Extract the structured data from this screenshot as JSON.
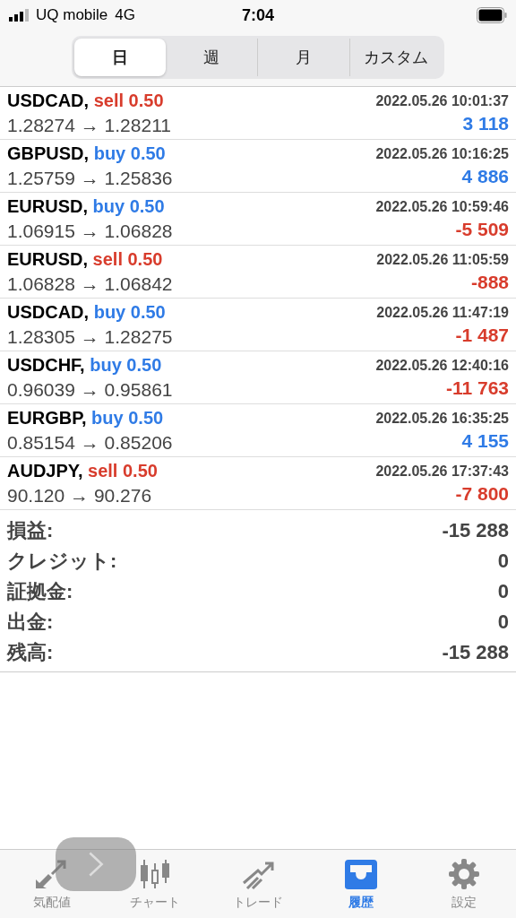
{
  "status_bar": {
    "carrier": "UQ mobile",
    "network": "4G",
    "time": "7:04"
  },
  "period_tabs": [
    {
      "label": "日",
      "selected": true
    },
    {
      "label": "週",
      "selected": false
    },
    {
      "label": "月",
      "selected": false
    },
    {
      "label": "カスタム",
      "selected": false
    }
  ],
  "deals": [
    {
      "symbol": "USDCAD,",
      "side": "sell",
      "volume": "0.50",
      "time": "2022.05.26 10:01:37",
      "prices": "1.28274 → 1.28211",
      "profit": "3 118",
      "positive": true
    },
    {
      "symbol": "GBPUSD,",
      "side": "buy",
      "volume": "0.50",
      "time": "2022.05.26 10:16:25",
      "prices": "1.25759 → 1.25836",
      "profit": "4 886",
      "positive": true
    },
    {
      "symbol": "EURUSD,",
      "side": "buy",
      "volume": "0.50",
      "time": "2022.05.26 10:59:46",
      "prices": "1.06915 → 1.06828",
      "profit": "-5 509",
      "positive": false
    },
    {
      "symbol": "EURUSD,",
      "side": "sell",
      "volume": "0.50",
      "time": "2022.05.26 11:05:59",
      "prices": "1.06828 → 1.06842",
      "profit": "-888",
      "positive": false
    },
    {
      "symbol": "USDCAD,",
      "side": "buy",
      "volume": "0.50",
      "time": "2022.05.26 11:47:19",
      "prices": "1.28305 → 1.28275",
      "profit": "-1 487",
      "positive": false
    },
    {
      "symbol": "USDCHF,",
      "side": "buy",
      "volume": "0.50",
      "time": "2022.05.26 12:40:16",
      "prices": "0.96039 → 0.95861",
      "profit": "-11 763",
      "positive": false
    },
    {
      "symbol": "EURGBP,",
      "side": "buy",
      "volume": "0.50",
      "time": "2022.05.26 16:35:25",
      "prices": "0.85154 → 0.85206",
      "profit": "4 155",
      "positive": true
    },
    {
      "symbol": "AUDJPY,",
      "side": "sell",
      "volume": "0.50",
      "time": "2022.05.26 17:37:43",
      "prices": "90.120 → 90.276",
      "profit": "-7 800",
      "positive": false
    }
  ],
  "summary": [
    {
      "label": "損益:",
      "value": "-15 288"
    },
    {
      "label": "クレジット:",
      "value": "0"
    },
    {
      "label": "証拠金:",
      "value": "0"
    },
    {
      "label": "出金:",
      "value": "0"
    },
    {
      "label": "残高:",
      "value": "-15 288"
    }
  ],
  "tab_bar": [
    {
      "kind": "quotes",
      "label": "気配値",
      "selected": false
    },
    {
      "kind": "chart",
      "label": "チャート",
      "selected": false
    },
    {
      "kind": "trade",
      "label": "トレード",
      "selected": false
    },
    {
      "kind": "history",
      "label": "履歴",
      "selected": true
    },
    {
      "kind": "settings",
      "label": "設定",
      "selected": false
    }
  ]
}
